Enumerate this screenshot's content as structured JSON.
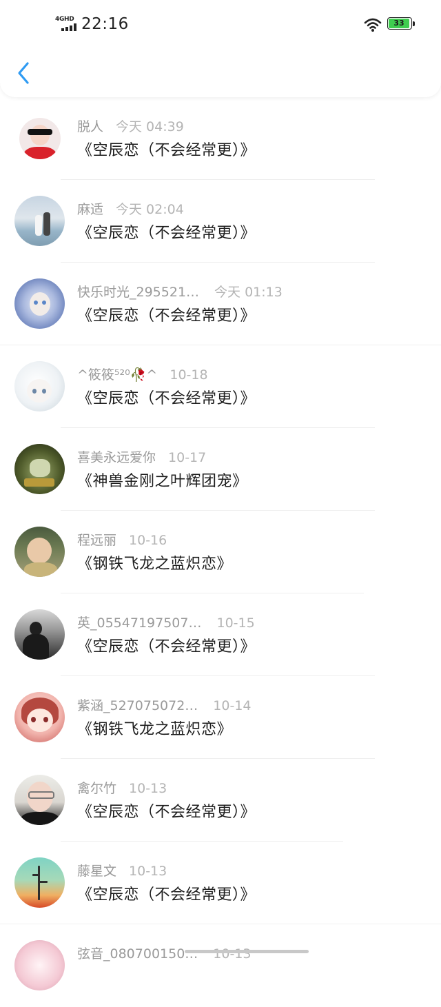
{
  "status_bar": {
    "network": "4GHD",
    "time": "22:16",
    "battery": "33"
  },
  "header": {
    "back_icon": "chevron-left-icon"
  },
  "colors": {
    "accent": "#2f9bf3",
    "battery_fill": "#3fcd4f"
  },
  "messages": [
    {
      "name": "脱人",
      "time": "今天 04:39",
      "title": "《空辰恋（不会经常更）》"
    },
    {
      "name": "麻适",
      "time": "今天 02:04",
      "title": "《空辰恋（不会经常更）》"
    },
    {
      "name": "快乐时光_295521…",
      "time": "今天 01:13",
      "title": "《空辰恋（不会经常更）》"
    },
    {
      "name": "^筱筱⁵²⁰🥀^",
      "time": "10-18",
      "title": "《空辰恋（不会经常更）》"
    },
    {
      "name": "喜美永远爱你",
      "time": "10-17",
      "title": "《神兽金刚之叶辉团宠》"
    },
    {
      "name": "程远丽",
      "time": "10-16",
      "title": "《钢铁飞龙之蓝炽恋》"
    },
    {
      "name": "英_05547197507…",
      "time": "10-15",
      "title": "《空辰恋（不会经常更）》"
    },
    {
      "name": "紫涵_527075072…",
      "time": "10-14",
      "title": "《钢铁飞龙之蓝炽恋》"
    },
    {
      "name": "禽尔竹",
      "time": "10-13",
      "title": "《空辰恋（不会经常更）》"
    },
    {
      "name": "藤星文",
      "time": "10-13",
      "title": "《空辰恋（不会经常更）》"
    },
    {
      "name": "弦音_080700150…",
      "time": "10-13",
      "title": ""
    }
  ]
}
